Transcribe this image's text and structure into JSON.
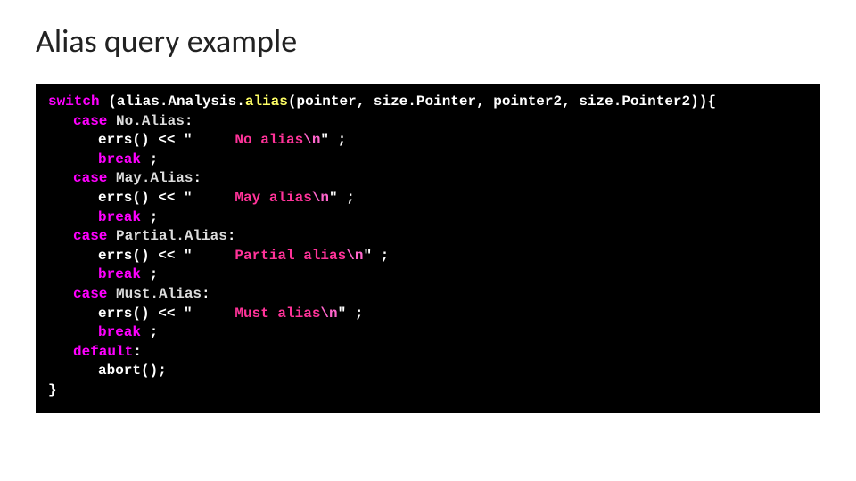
{
  "title": "Alias query example",
  "kw": {
    "switch": "switch",
    "case": "case",
    "break": "break",
    "default": "default"
  },
  "switchExpr": {
    "open": " (",
    "obj": "alias.Analysis.",
    "fn": "alias",
    "args": "(pointer, size.Pointer, pointer2, size.Pointer2)",
    "close": "){"
  },
  "cases": {
    "c0": {
      "id": "No.Alias",
      "msg": "No alias",
      "esc": "\\n"
    },
    "c1": {
      "id": "May.Alias",
      "msg": "May alias",
      "esc": "\\n"
    },
    "c2": {
      "id": "Partial.Alias",
      "msg": "Partial alias",
      "esc": "\\n"
    },
    "c3": {
      "id": "Must.Alias",
      "msg": "Must alias",
      "esc": "\\n"
    }
  },
  "errCall": {
    "pre": "errs() << ",
    "gap": "    ",
    "tail": " ;"
  },
  "q": "\"",
  "semi": " ;",
  "colon": ":",
  "abort": "abort();",
  "closeBrace": "}"
}
